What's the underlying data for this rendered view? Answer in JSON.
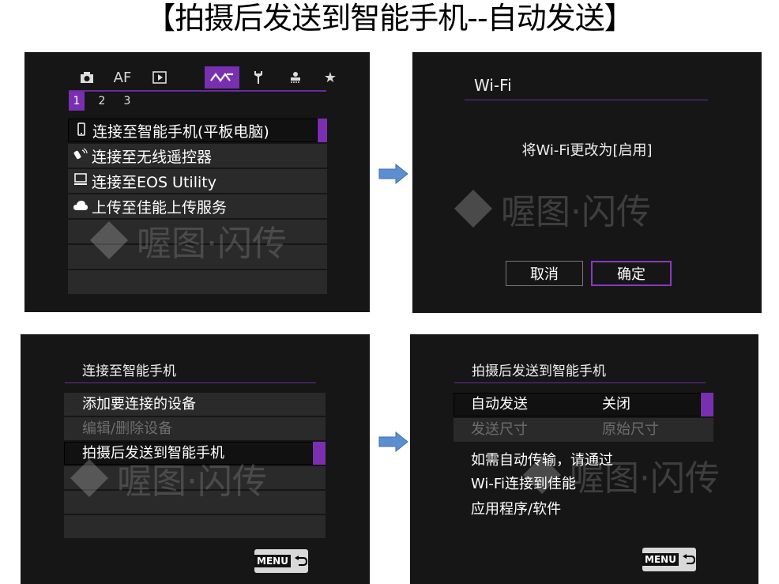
{
  "page_title": "【拍摄后发送到智能手机--自动发送】",
  "watermark_text": "喔图·闪传",
  "screen1": {
    "tabs": [
      "camera-icon",
      "AF",
      "play-icon",
      "wireless-icon",
      "wrench-icon",
      "custom-icon",
      "star-icon"
    ],
    "tab_af_label": "AF",
    "subtabs": [
      "1",
      "2",
      "3"
    ],
    "items": [
      {
        "icon": "smartphone-icon",
        "label": "连接至智能手机(平板电脑)"
      },
      {
        "icon": "remote-icon",
        "label": "连接至无线遥控器"
      },
      {
        "icon": "computer-icon",
        "label": "连接至EOS Utility"
      },
      {
        "icon": "cloud-icon",
        "label": "上传至佳能上传服务"
      }
    ]
  },
  "screen2": {
    "title": "Wi-Fi",
    "message": "将Wi-Fi更改为[启用]",
    "cancel_label": "取消",
    "ok_label": "确定"
  },
  "screen3": {
    "title": "连接至智能手机",
    "items": [
      {
        "label": "添加要连接的设备",
        "state": "normal"
      },
      {
        "label": "编辑/删除设备",
        "state": "disabled"
      },
      {
        "label": "拍摄后发送到智能手机",
        "state": "selected"
      }
    ],
    "menu_label": "MENU"
  },
  "screen4": {
    "title": "拍摄后发送到智能手机",
    "rows": [
      {
        "key": "自动发送",
        "value": "关闭",
        "state": "selected"
      },
      {
        "key": "发送尺寸",
        "value": "原始尺寸",
        "state": "disabled"
      }
    ],
    "note_lines": [
      "如需自动传输，请通过",
      "Wi-Fi连接到佳能",
      "应用程序/软件"
    ],
    "menu_label": "MENU"
  },
  "colors": {
    "accent": "#7a2fb0",
    "arrow": "#5b8fd0",
    "screen_bg": "#161616"
  }
}
